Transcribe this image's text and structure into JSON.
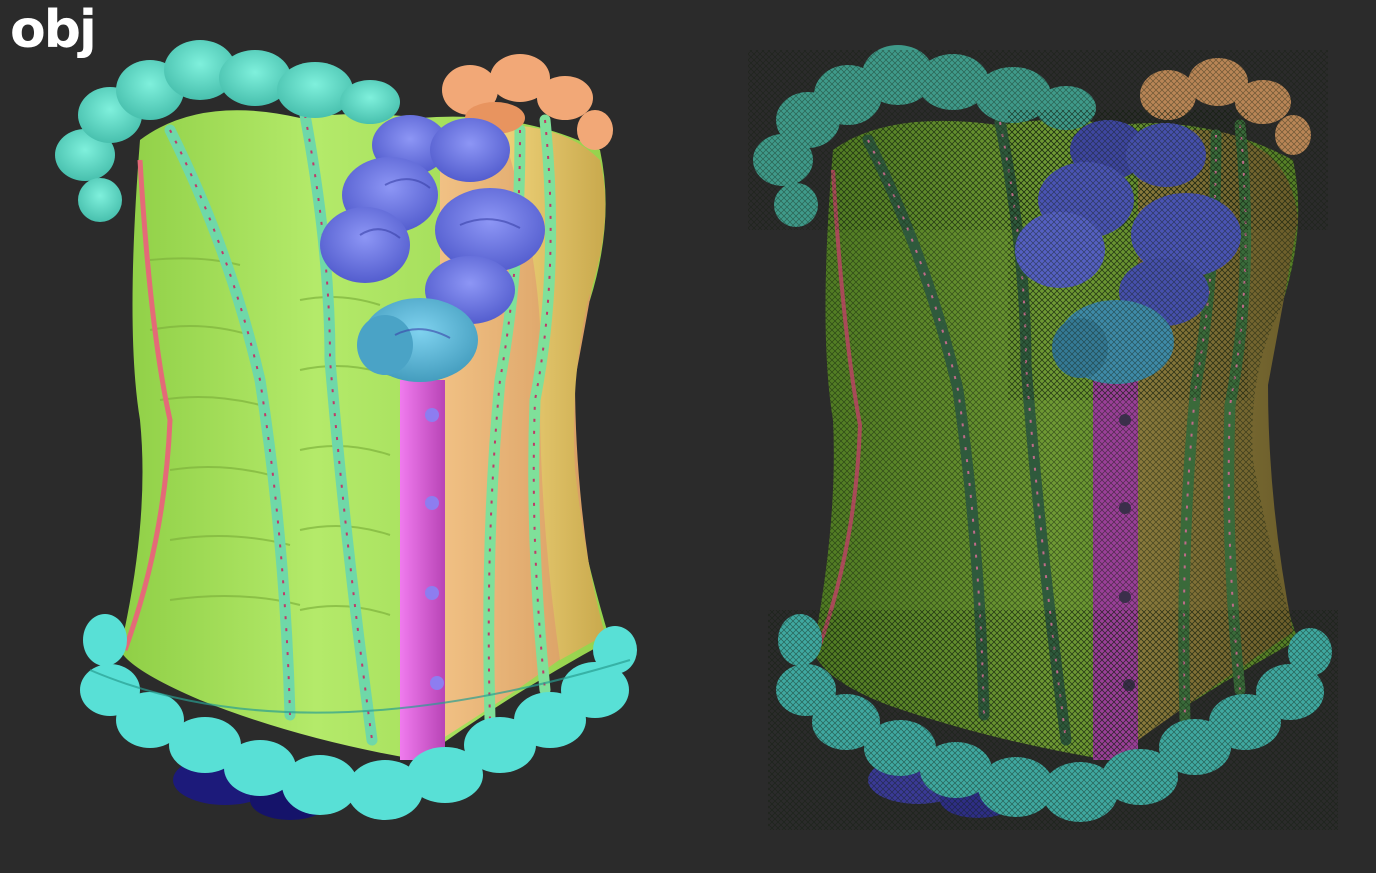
{
  "corner_label": "obj",
  "colors": {
    "background": "#2b2b2b",
    "body_green": "#a6e05a",
    "panel_yellow": "#e6c96a",
    "panel_orange": "#e8b77a",
    "busk_pink": "#d85bd6",
    "piping_red": "#e46a78",
    "ruffle_teal": "#5fd9c2",
    "ruffle_aqua": "#58e0d6",
    "ruffle_peach": "#f2a877",
    "flower_blue": "#6f7be8",
    "flower_lightblue": "#5bb9db",
    "boning_tape": "#6fd8a8",
    "underskirt_navy": "#1c1a7a",
    "wire_dark": "#0e1a0a"
  },
  "views": [
    {
      "id": "smooth-shaded",
      "style": "shaded"
    },
    {
      "id": "wireframe-overlay",
      "style": "wireframe"
    }
  ]
}
